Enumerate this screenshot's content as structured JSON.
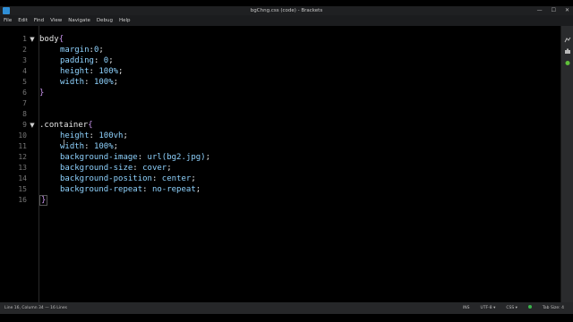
{
  "window": {
    "title": "bgChng.css (code) - Brackets",
    "controls": {
      "minimize": "—",
      "maximize": "☐",
      "close": "✕"
    }
  },
  "menu": [
    "File",
    "Edit",
    "Find",
    "View",
    "Navigate",
    "Debug",
    "Help"
  ],
  "editor": {
    "line_numbers": [
      "1",
      "2",
      "3",
      "4",
      "5",
      "6",
      "7",
      "8",
      "9",
      "10",
      "11",
      "12",
      "13",
      "14",
      "15",
      "16"
    ],
    "folds": {
      "1": "▼",
      "9": "▼"
    }
  },
  "code": {
    "l1": {
      "selector": "body",
      "brace": "{"
    },
    "l2": {
      "prop": "margin",
      "colon": ":",
      "val": "0",
      "semi": ";"
    },
    "l3": {
      "prop": "padding",
      "colon": ": ",
      "val": "0",
      "semi": ";"
    },
    "l4": {
      "prop": "height",
      "colon": ": ",
      "val": "100%",
      "semi": ";"
    },
    "l5": {
      "prop": "width",
      "colon": ": ",
      "val": "100%",
      "semi": ";"
    },
    "l6": {
      "brace": "}"
    },
    "l9": {
      "selector": ".container",
      "brace": "{"
    },
    "l10": {
      "prop": "height",
      "colon": ": ",
      "val": "100vh",
      "semi": ";"
    },
    "l11": {
      "prop": "width",
      "colon": ": ",
      "val": "100%",
      "semi": ";"
    },
    "l12": {
      "prop": "background-image",
      "colon": ": ",
      "val": "url(bg2.jpg)",
      "semi": ";"
    },
    "l13": {
      "prop": "background-size",
      "colon": ": ",
      "val": "cover",
      "semi": ";"
    },
    "l14": {
      "prop": "background-position",
      "colon": ": ",
      "val": "center",
      "semi": ";"
    },
    "l15": {
      "prop": "background-repeat",
      "colon": ": ",
      "val": "no-repeat",
      "semi": ";"
    },
    "l16": {
      "brace": "}"
    }
  },
  "status": {
    "position": "Line 16, Column 34 — 16 Lines",
    "ins": "INS",
    "encoding": "UTF-8 ▾",
    "language": "CSS ▾",
    "tab_size": "Tab Size: 4"
  },
  "colors": {
    "property": "#8fd3ff",
    "brace": "#c792ea",
    "accent": "#2f8fd7",
    "status_ok": "#39b54a"
  },
  "icons": {
    "app": "brackets-app-icon",
    "live_preview": "live-preview-icon",
    "extensions": "extension-manager-icon",
    "debug": "debug-icon"
  }
}
